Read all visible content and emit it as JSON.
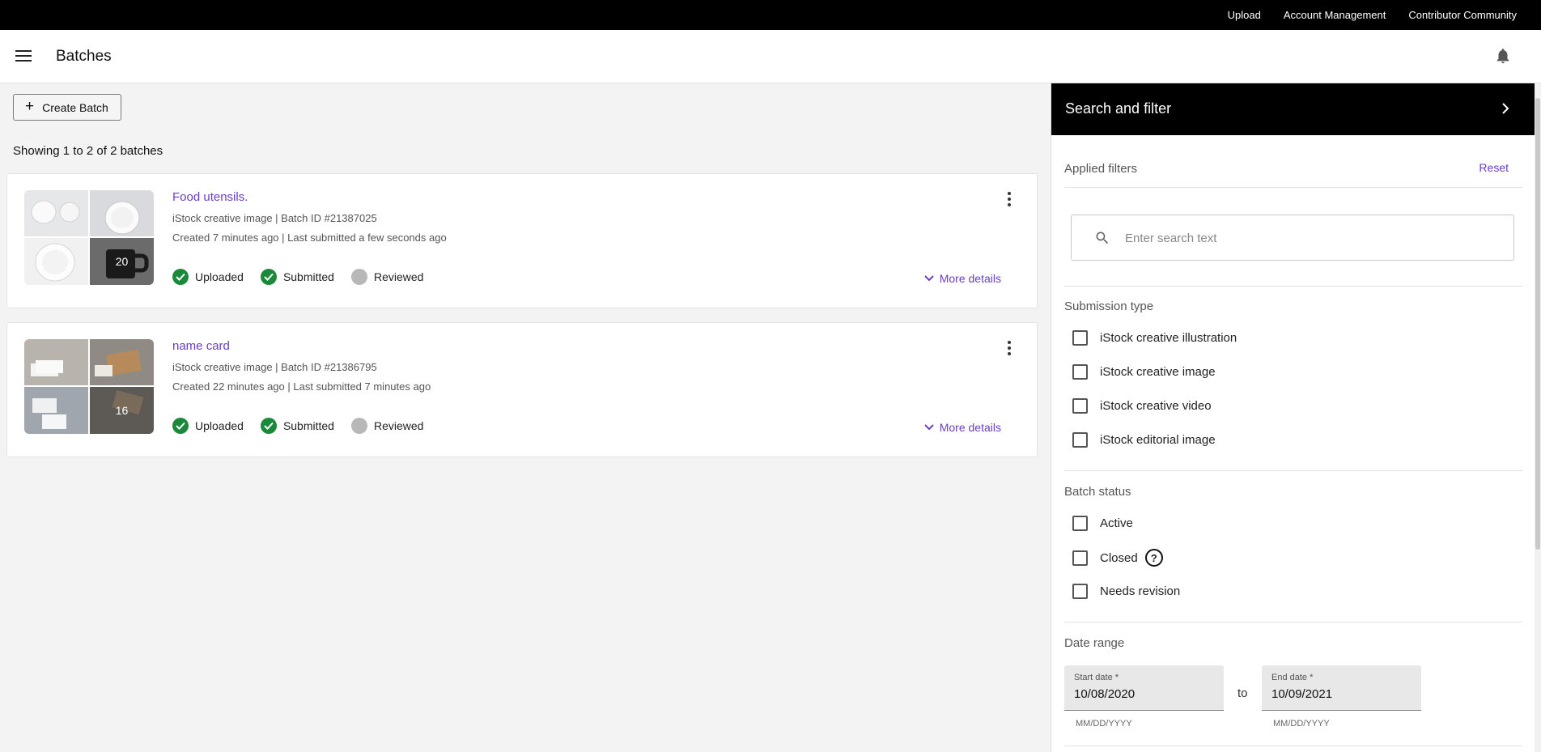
{
  "topnav": {
    "upload": "Upload",
    "account": "Account Management",
    "community": "Contributor Community"
  },
  "header": {
    "title": "Batches"
  },
  "toolbar": {
    "create_label": "Create Batch"
  },
  "summary": "Showing 1 to 2 of 2 batches",
  "batches": [
    {
      "title": "Food utensils.",
      "type_line": "iStock creative image | Batch ID #21387025",
      "time_line": "Created 7 minutes ago | Last submitted a few seconds ago",
      "count": "20",
      "statuses": [
        "Uploaded",
        "Submitted",
        "Reviewed"
      ],
      "more": "More details"
    },
    {
      "title": "name card",
      "type_line": "iStock creative image | Batch ID #21386795",
      "time_line": "Created 22 minutes ago | Last submitted 7 minutes ago",
      "count": "16",
      "statuses": [
        "Uploaded",
        "Submitted",
        "Reviewed"
      ],
      "more": "More details"
    }
  ],
  "panel": {
    "title": "Search and filter",
    "applied": "Applied filters",
    "reset": "Reset",
    "search_placeholder": "Enter search text",
    "submission_type": {
      "label": "Submission type",
      "options": [
        "iStock creative illustration",
        "iStock creative image",
        "iStock creative video",
        "iStock editorial image"
      ]
    },
    "batch_status": {
      "label": "Batch status",
      "options": [
        "Active",
        "Closed",
        "Needs revision"
      ]
    },
    "date_range": {
      "label": "Date range",
      "start_label": "Start date *",
      "start_value": "10/08/2020",
      "end_label": "End date *",
      "end_value": "10/09/2021",
      "to": "to",
      "hint": "MM/DD/YYYY"
    }
  },
  "colors": {
    "accent": "#6a3ec6",
    "success": "#1a8a3a",
    "pending": "#b8b8b8"
  }
}
